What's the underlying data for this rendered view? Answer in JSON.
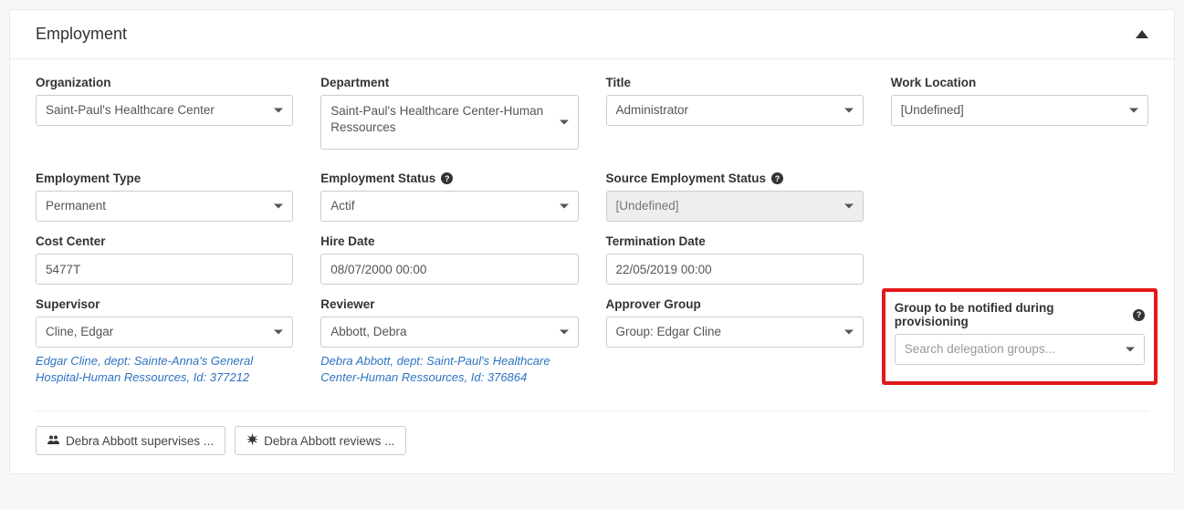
{
  "panel": {
    "title": "Employment"
  },
  "labels": {
    "organization": "Organization",
    "department": "Department",
    "title": "Title",
    "workLocation": "Work Location",
    "employmentType": "Employment Type",
    "employmentStatus": "Employment Status",
    "sourceEmploymentStatus": "Source Employment Status",
    "costCenter": "Cost Center",
    "hireDate": "Hire Date",
    "terminationDate": "Termination Date",
    "supervisor": "Supervisor",
    "reviewer": "Reviewer",
    "approverGroup": "Approver Group",
    "notifyGroup": "Group to be notified during provisioning"
  },
  "values": {
    "organization": "Saint-Paul's Healthcare Center",
    "department": "Saint-Paul's Healthcare Center-Human Ressources",
    "title": "Administrator",
    "workLocation": "[Undefined]",
    "employmentType": "Permanent",
    "employmentStatus": "Actif",
    "sourceEmploymentStatus": "[Undefined]",
    "costCenter": "5477T",
    "hireDate": "08/07/2000 00:00",
    "terminationDate": "22/05/2019 00:00",
    "supervisor": "Cline, Edgar",
    "reviewer": "Abbott, Debra",
    "approverGroup": "Group: Edgar Cline",
    "notifyGroupPlaceholder": "Search delegation groups..."
  },
  "supervisorLink": {
    "name": "Edgar Cline",
    "deptLabel": "dept:",
    "dept": "Sainte-Anna's General Hospital-Human Ressources",
    "idLabel": "Id:",
    "id": "377212"
  },
  "reviewerLink": {
    "name": "Debra Abbott",
    "deptLabel": "dept:",
    "dept": "Saint-Paul's Healthcare Center-Human Ressources",
    "idLabel": "Id:",
    "id": "376864"
  },
  "buttons": {
    "supervises": "Debra Abbott supervises ...",
    "reviews": "Debra Abbott reviews ..."
  },
  "highlight": {
    "color": "#e11a1a"
  }
}
